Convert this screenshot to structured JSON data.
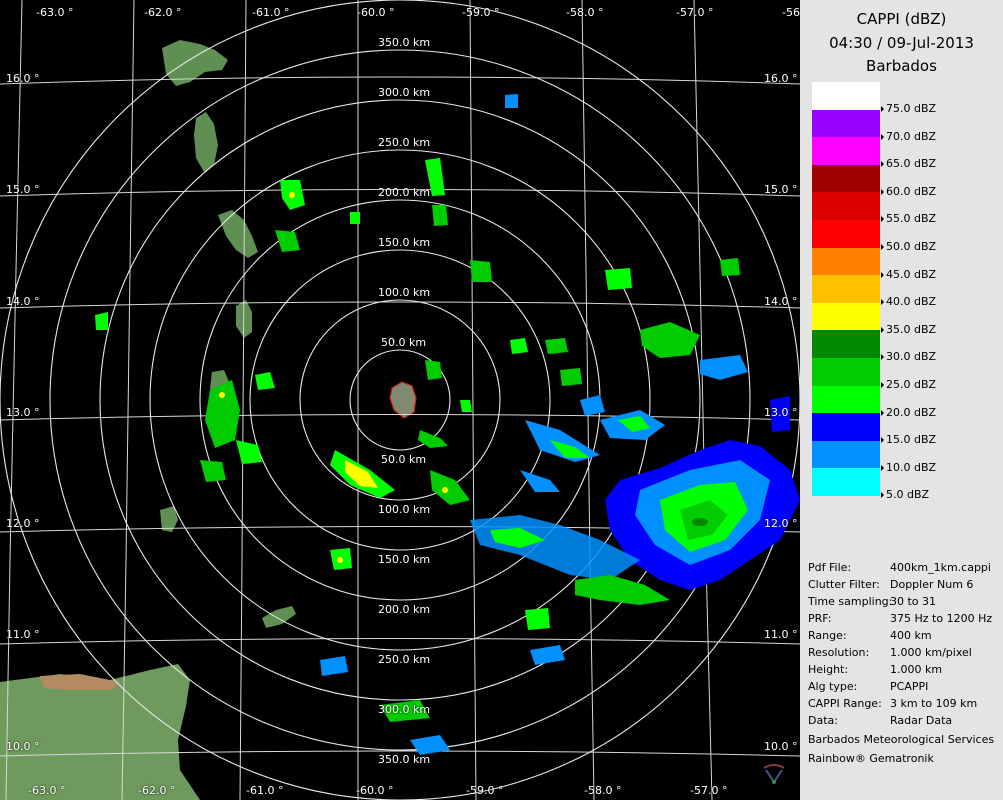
{
  "title": {
    "product": "CAPPI (dBZ)",
    "datetime": "04:30 / 09-Jul-2013",
    "site": "Barbados"
  },
  "longitudes": [
    "-63.0 °",
    "-62.0 °",
    "-61.0 °",
    "-60.0 °",
    "-59.0 °",
    "-58.0 °",
    "-57.0 °",
    "-56"
  ],
  "latitudes": [
    "16.0 °",
    "15.0 °",
    "14.0 °",
    "13.0 °",
    "12.0 °",
    "11.0 °",
    "10.0 °"
  ],
  "range_labels": [
    "50.0 km",
    "100.0 km",
    "150.0 km",
    "200.0 km",
    "250.0 km",
    "300.0 km",
    "350.0 km"
  ],
  "legend": [
    {
      "label": "75.0 dBZ",
      "color": "#ffffff"
    },
    {
      "label": "70.0 dBZ",
      "color": "#9900ff"
    },
    {
      "label": "65.0 dBZ",
      "color": "#ff00ff"
    },
    {
      "label": "60.0 dBZ",
      "color": "#a00000"
    },
    {
      "label": "55.0 dBZ",
      "color": "#dd0000"
    },
    {
      "label": "50.0 dBZ",
      "color": "#ff0000"
    },
    {
      "label": "45.0 dBZ",
      "color": "#ff8000"
    },
    {
      "label": "40.0 dBZ",
      "color": "#ffc000"
    },
    {
      "label": "35.0 dBZ",
      "color": "#ffff00"
    },
    {
      "label": "30.0 dBZ",
      "color": "#008800"
    },
    {
      "label": "25.0 dBZ",
      "color": "#00cc00"
    },
    {
      "label": "20.0 dBZ",
      "color": "#00ff00"
    },
    {
      "label": "15.0 dBZ",
      "color": "#0000ff"
    },
    {
      "label": "10.0 dBZ",
      "color": "#0090ff"
    },
    {
      "label": "5.0 dBZ",
      "color": "#00ffff"
    }
  ],
  "info": [
    {
      "key": "Pdf File:",
      "value": "400km_1km.cappi"
    },
    {
      "key": "Clutter Filter:",
      "value": "Doppler Num 6"
    },
    {
      "key": "Time sampling:",
      "value": "30 to 31"
    },
    {
      "key": "PRF:",
      "value": "375 Hz to 1200 Hz"
    },
    {
      "key": "Range:",
      "value": "400 km"
    },
    {
      "key": "Resolution:",
      "value": "1.000 km/pixel"
    },
    {
      "key": "Height:",
      "value": "1.000 km"
    },
    {
      "key": "Alg type:",
      "value": "PCAPPI"
    },
    {
      "key": "CAPPI Range:",
      "value": "3 km to 109 km"
    },
    {
      "key": "Data:",
      "value": "Radar Data"
    }
  ],
  "footer": {
    "organization": "Barbados Meteorological Services",
    "software": "Rainbow® Gematronik"
  }
}
